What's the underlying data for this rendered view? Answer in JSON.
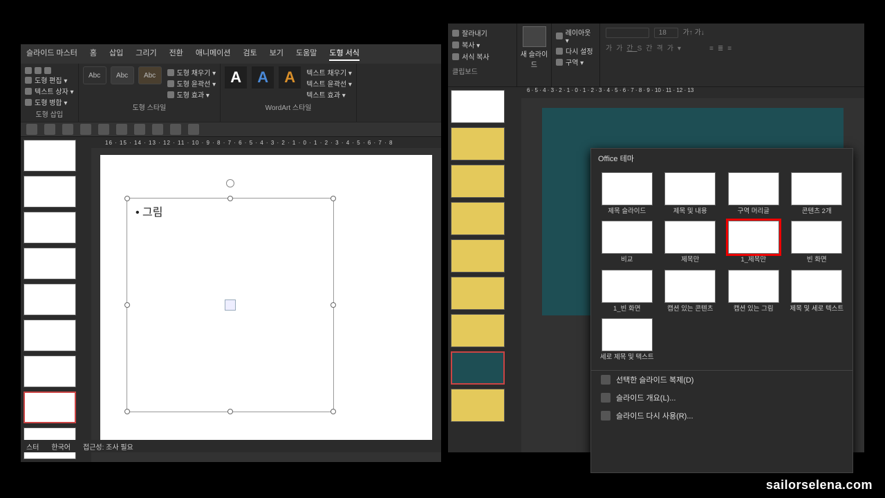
{
  "left": {
    "menus": [
      "슬라이드 마스터",
      "홈",
      "삽입",
      "그리기",
      "전환",
      "애니메이션",
      "검토",
      "보기",
      "도움말",
      "도형 서식"
    ],
    "active_menu": "도형 서식",
    "ribbon": {
      "insert_group": "도형 삽입",
      "insert_items": [
        "도형 편집 ▾",
        "텍스트 상자 ▾",
        "도형 병합 ▾"
      ],
      "style_group": "도형 스타일",
      "style_chip": "Abc",
      "style_items": [
        "도형 채우기 ▾",
        "도형 윤곽선 ▾",
        "도형 효과 ▾"
      ],
      "wordart_group": "WordArt 스타일",
      "wordart_items": [
        "텍스트 채우기 ▾",
        "텍스트 윤곽선 ▾",
        "텍스트 효과 ▾"
      ]
    },
    "ruler_h": "16 · 15 · 14 · 13 · 12 · 11 · 10 · 9 · 8 · 7 · 6 · 5 · 4 · 3 · 2 · 1 · 0 · 1 · 2 · 3 · 4 · 5 · 6 · 7 · 8",
    "placeholder_text": "• 그림",
    "status": {
      "master": "스터",
      "lang": "한국어",
      "access": "접근성: 조사 필요"
    }
  },
  "right": {
    "clip": {
      "cut": "잘라내기",
      "copy": "복사 ▾",
      "paste": "서식 복사",
      "group": "클립보드"
    },
    "newslide": {
      "label": "새 슬라이드"
    },
    "layout_items": [
      "레이아웃 ▾",
      "다시 설정",
      "구역 ▾"
    ],
    "font_size": "18",
    "gallery": {
      "title": "Office 테마",
      "items": [
        {
          "label": "제목 슬라이드"
        },
        {
          "label": "제목 및 내용"
        },
        {
          "label": "구역 머리글"
        },
        {
          "label": "콘텐츠 2개"
        },
        {
          "label": "비교"
        },
        {
          "label": "제목만"
        },
        {
          "label": "1_제목만",
          "hl": true
        },
        {
          "label": "빈 화면"
        },
        {
          "label": "1_빈 화면"
        },
        {
          "label": "캡션 있는 콘텐츠"
        },
        {
          "label": "캡션 있는 그림"
        },
        {
          "label": "제목 및 세로 텍스트"
        },
        {
          "label": "세로 제목 및 텍스트"
        }
      ],
      "menu": [
        "선택한 슬라이드 복제(D)",
        "슬라이드 개요(L)...",
        "슬라이드 다시 사용(R)..."
      ]
    },
    "ruler_h": "6 · 5 · 4 · 3 · 2 · 1 · 0 · 1 · 2 · 3 · 4 · 5 · 6 · 7 · 8 · 9 · 10 · 11 · 12 · 13"
  },
  "watermark": "sailorselena.com"
}
